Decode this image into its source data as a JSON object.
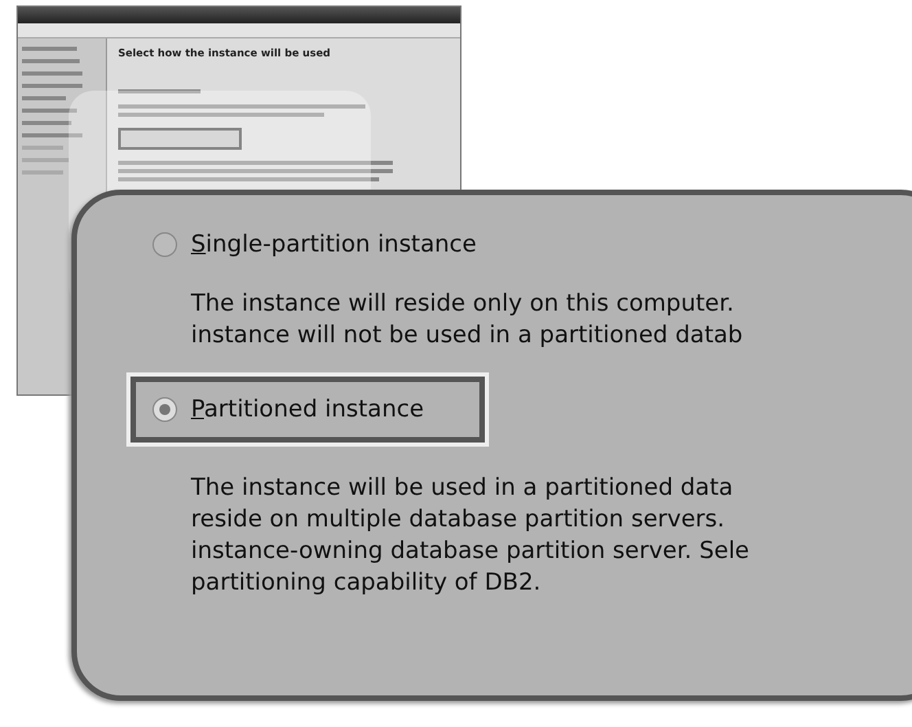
{
  "dialog": {
    "heading": "Select how the instance will be used"
  },
  "callout": {
    "options": [
      {
        "label": "Single-partition instance",
        "selected": false,
        "highlighted": false,
        "description": [
          "The instance will reside only on this computer.",
          "instance will not be used in a partitioned datab"
        ]
      },
      {
        "label": "Partitioned instance",
        "selected": true,
        "highlighted": true,
        "description": [
          "The instance will be used in a partitioned data",
          "reside on multiple database partition servers.",
          "instance-owning database partition server. Sele",
          "partitioning capability of DB2."
        ]
      }
    ]
  }
}
